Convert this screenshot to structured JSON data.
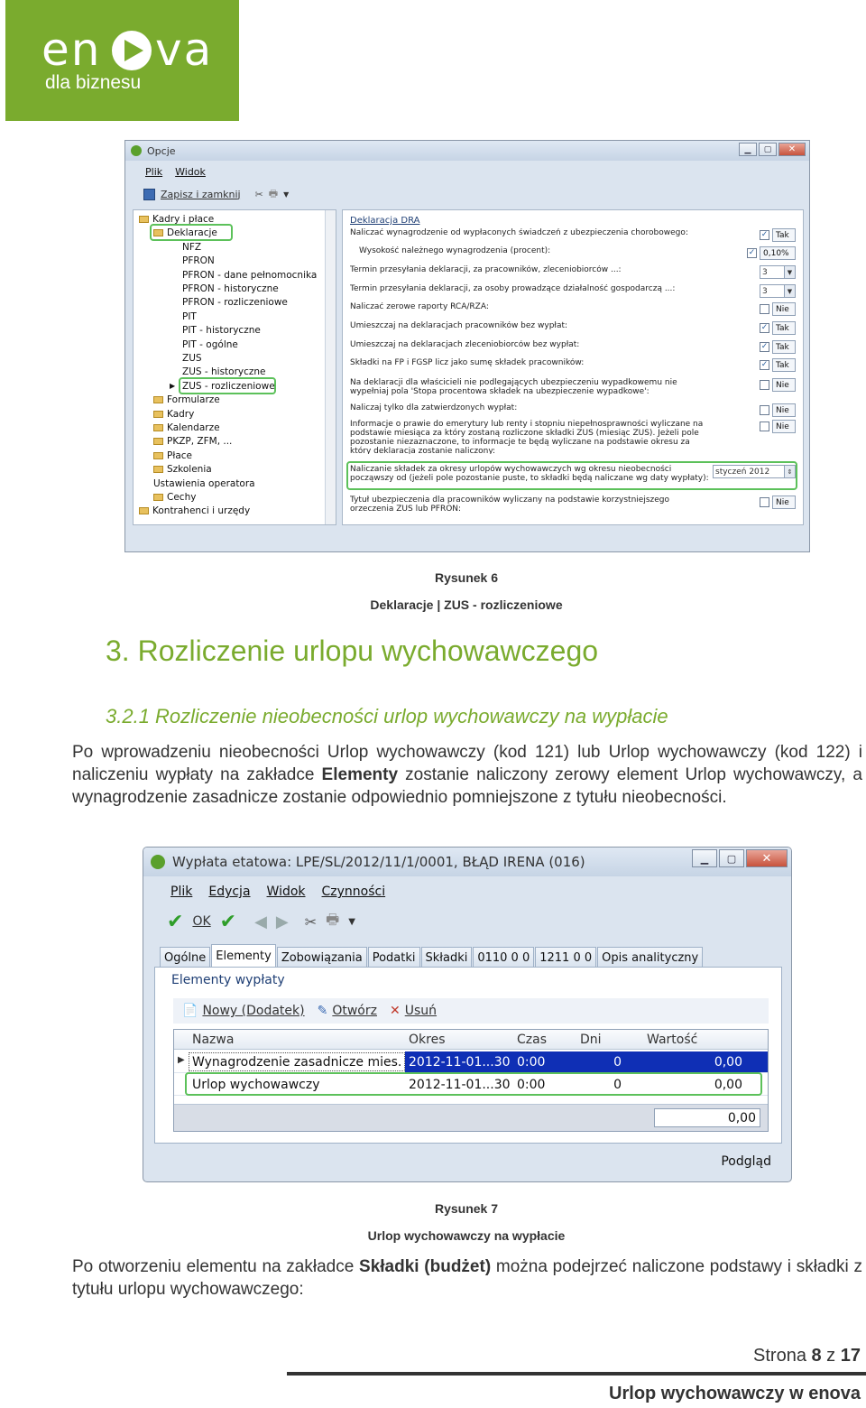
{
  "brand": {
    "logo_text": "enova",
    "tagline": "dla biznesu",
    "color": "#7aab2e"
  },
  "figure6": {
    "window_title": "Opcje",
    "menu": [
      "Plik",
      "Widok"
    ],
    "toolbar": {
      "save_label": "Zapisz i zamknij"
    },
    "tree": [
      {
        "label": "Kadry i płace",
        "level": 0,
        "folder": true
      },
      {
        "label": "Deklaracje",
        "level": 1,
        "folder": true,
        "highlight": true
      },
      {
        "label": "NFZ",
        "level": 2
      },
      {
        "label": "PFRON",
        "level": 2
      },
      {
        "label": "PFRON - dane pełnomocnika",
        "level": 2
      },
      {
        "label": "PFRON - historyczne",
        "level": 2
      },
      {
        "label": "PFRON - rozliczeniowe",
        "level": 2
      },
      {
        "label": "PIT",
        "level": 2
      },
      {
        "label": "PIT - historyczne",
        "level": 2
      },
      {
        "label": "PIT - ogólne",
        "level": 2
      },
      {
        "label": "ZUS",
        "level": 2
      },
      {
        "label": "ZUS - historyczne",
        "level": 2
      },
      {
        "label": "ZUS - rozliczeniowe",
        "level": 2,
        "highlight": true,
        "selected": true
      },
      {
        "label": "Formularze",
        "level": 1,
        "folder": true
      },
      {
        "label": "Kadry",
        "level": 1,
        "folder": true
      },
      {
        "label": "Kalendarze",
        "level": 1,
        "folder": true
      },
      {
        "label": "PKZP, ZFM, ...",
        "level": 1,
        "folder": true
      },
      {
        "label": "Płace",
        "level": 1,
        "folder": true
      },
      {
        "label": "Szkolenia",
        "level": 1,
        "folder": true
      },
      {
        "label": "Ustawienia operatora",
        "level": 1
      },
      {
        "label": "Cechy",
        "level": 1,
        "folder": true
      },
      {
        "label": "Kontrahenci i urzędy",
        "level": 0,
        "folder": true
      }
    ],
    "panel_title": "Deklaracja DRA",
    "settings": [
      {
        "text": "Naliczać wynagrodzenie od wypłaconych świadczeń z ubezpieczenia chorobowego:",
        "type": "check",
        "checked": true,
        "value": "Tak"
      },
      {
        "text": "Wysokość należnego wynagrodzenia (procent):",
        "type": "value",
        "value": "0,10%",
        "indent": true
      },
      {
        "text": "Termin przesyłania deklaracji, za pracowników, zleceniobiorców ...:",
        "type": "combo",
        "value": "3"
      },
      {
        "text": "Termin przesyłania deklaracji, za osoby prowadzące działalność gospodarczą ...:",
        "type": "combo",
        "value": "3"
      },
      {
        "text": "Naliczać zerowe raporty RCA/RZA:",
        "type": "check",
        "checked": false,
        "value": "Nie"
      },
      {
        "text": "Umieszczaj na deklaracjach pracowników bez wypłat:",
        "type": "check",
        "checked": true,
        "value": "Tak"
      },
      {
        "text": "Umieszczaj na deklaracjach zleceniobiorców bez wypłat:",
        "type": "check",
        "checked": true,
        "value": "Tak"
      },
      {
        "text": "Składki na FP i FGŚP licz jako sumę składek pracowników:",
        "type": "check",
        "checked": true,
        "value": "Tak"
      },
      {
        "text": "Na deklaracji dla właścicieli nie podlegających ubezpieczeniu wypadkowemu nie wypełniaj pola 'Stopa procentowa składek na ubezpieczenie wypadkowe':",
        "type": "check",
        "checked": false,
        "value": "Nie"
      },
      {
        "text": "Naliczaj tylko dla zatwierdzonych wypłat:",
        "type": "check",
        "checked": false,
        "value": "Nie"
      },
      {
        "text": "Informacje o prawie do emerytury lub renty i stopniu niepełnosprawności wyliczane na podstawie miesiąca za który zostaną rozliczone składki ZUS (miesiąc ZUS). Jeżeli pole pozostanie niezaznaczone, to informacje te będą wyliczane na podstawie okresu za który deklaracja zostanie naliczony:",
        "type": "check",
        "checked": false,
        "value": "Nie"
      },
      {
        "text": "Naliczanie składek za okresy urlopów wychowawczych wg okresu nieobecności począwszy od (jeżeli pole pozostanie puste, to składki będą naliczane wg daty wypłaty):",
        "type": "date",
        "value": "styczeń 2012",
        "highlight": true
      },
      {
        "text": "Tytuł ubezpieczenia dla pracowników wyliczany na podstawie korzystniejszego orzeczenia ZUS lub PFRON:",
        "type": "check",
        "checked": false,
        "value": "Nie"
      }
    ]
  },
  "caption6": {
    "label": "Rysunek 6",
    "title": "Deklaracje | ZUS - rozliczeniowe"
  },
  "heading1": "3. Rozliczenie urlopu wychowawczego",
  "heading2": "3.2.1  Rozliczenie nieobecności urlop wychowawczy na wypłacie",
  "para1": {
    "pre": "Po wprowadzeniu nieobecności Urlop wychowawczy (kod 121) lub Urlop wychowawczy (kod 122) i naliczeniu wypłaty na zakładce ",
    "bold": "Elementy",
    "post": " zostanie naliczony zerowy element Urlop wychowawczy, a wynagrodzenie zasadnicze zostanie odpowiednio pomniejszone z tytułu nieobecności."
  },
  "figure7": {
    "window_title": "Wypłata etatowa: LPE/SL/2012/11/1/0001, BŁĄD IRENA (016)",
    "menu": [
      "Plik",
      "Edycja",
      "Widok",
      "Czynności"
    ],
    "ok_label": "OK",
    "tabs": [
      "Ogólne",
      "Elementy",
      "Zobowiązania",
      "Podatki",
      "Składki",
      "0110 0 0",
      "1211 0 0",
      "Opis analityczny"
    ],
    "active_tab": 1,
    "section_title": "Elementy wypłaty",
    "actions": [
      "Nowy (Dodatek)",
      "Otwórz",
      "Usuń"
    ],
    "columns": [
      "Nazwa",
      "Okres",
      "Czas",
      "Dni",
      "Wartość"
    ],
    "rows": [
      {
        "nazwa": "Wynagrodzenie zasadnicze mies.",
        "okres": "2012-11-01...30",
        "czas": "0:00",
        "dni": "0",
        "wartosc": "0,00",
        "current": true
      },
      {
        "nazwa": "Urlop wychowawczy",
        "okres": "2012-11-01...30",
        "czas": "0:00",
        "dni": "0",
        "wartosc": "0,00",
        "highlight": true
      }
    ],
    "total": "0,00",
    "preview_label": "Podgląd"
  },
  "caption7": {
    "label": "Rysunek 7",
    "title": "Urlop wychowawczy na wypłacie"
  },
  "para2": {
    "pre": "Po otworzeniu elementu na zakładce ",
    "bold": "Składki (budżet)",
    "post": " można podejrzeć naliczone podstawy i składki z tytułu urlopu wychowawczego:"
  },
  "footer": {
    "page_prefix": "Strona ",
    "page": "8",
    "page_mid": " z ",
    "pages": "17",
    "doc_title": "Urlop wychowawczy w enova"
  }
}
